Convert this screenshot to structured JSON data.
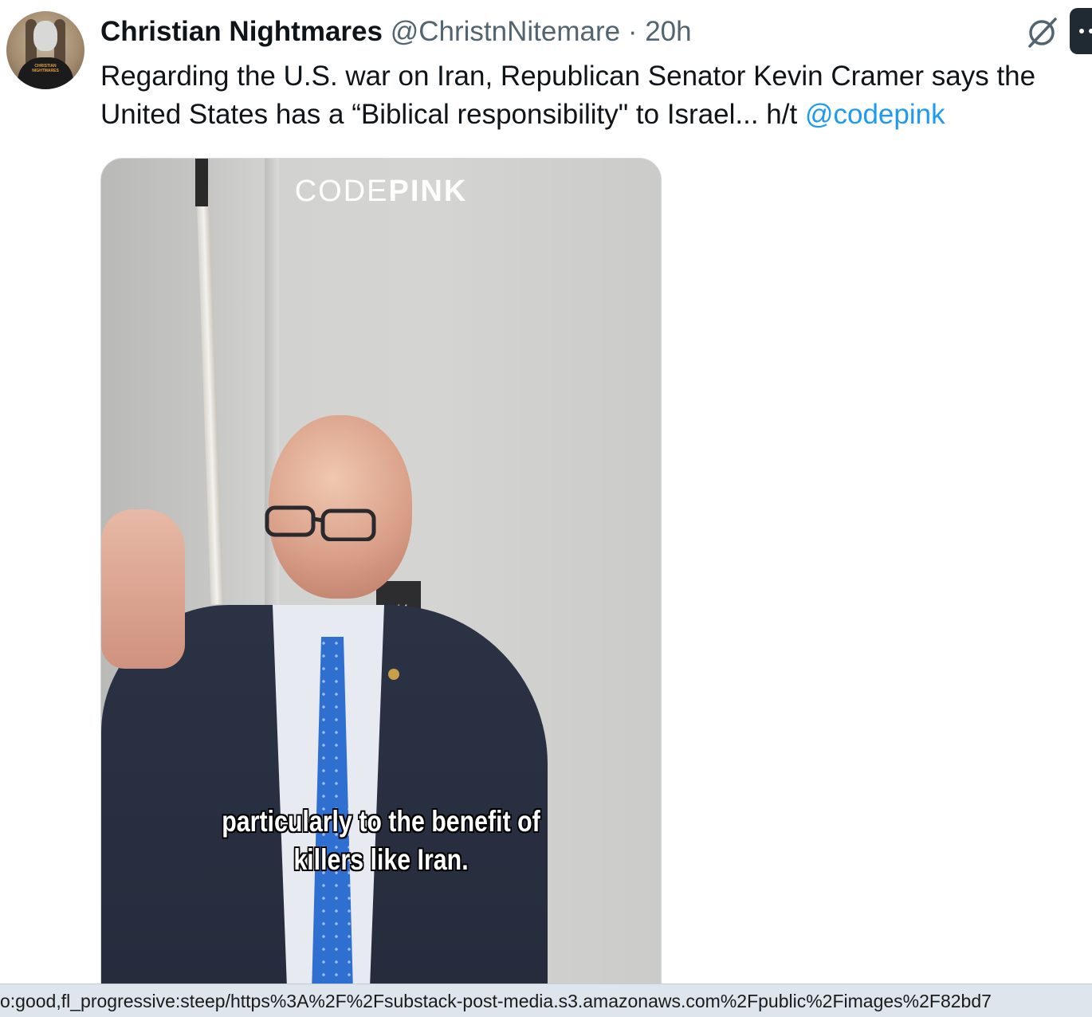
{
  "tweet": {
    "display_name": "Christian Nightmares",
    "handle": "@ChristnNitemare",
    "separator": "·",
    "time": "20h",
    "text_main": "Regarding the U.S. war on Iran, Republican Senator Kevin Cramer says the United States has a “Biblical responsibility\" to Israel... h/t ",
    "mention": "@codepink",
    "avatar_shirt_text": "CHRISTIAN NIGHTMARES"
  },
  "icons": {
    "grok": "grok-icon",
    "more": "more-icon"
  },
  "media": {
    "watermark_light": "CODE",
    "watermark_bold": "PINK",
    "sign_number": "14",
    "caption_line1": "particularly to the benefit of",
    "caption_line2": "killers like Iran."
  },
  "status_bar": {
    "url": "o:good,fl_progressive:steep/https%3A%2F%2Fsubstack-post-media.s3.amazonaws.com%2Fpublic%2Fimages%2F82bd7"
  },
  "colors": {
    "text": "#0f1419",
    "secondary": "#536471",
    "link": "#1d9bf0",
    "status_bar_bg": "#dee5ec"
  }
}
